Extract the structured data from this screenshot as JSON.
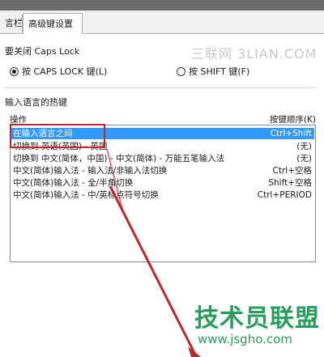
{
  "tabs": [
    {
      "label": "言栏",
      "active": false
    },
    {
      "label": "高级键设置",
      "active": true
    }
  ],
  "caps_lock": {
    "title": "要关闭 Caps Lock",
    "options": [
      {
        "label": "按 CAPS LOCK 键(L)",
        "checked": true
      },
      {
        "label": "按 SHIFT 键(F)",
        "checked": false
      }
    ]
  },
  "watermark_top": "三联网 3LIAN.COM",
  "hotkeys": {
    "title": "输入语言的热键",
    "col_action": "操作",
    "col_keys": "按键顺序(K)",
    "rows": [
      {
        "action": "在输入语言之间",
        "keys": "Ctrl+Shift",
        "selected": true
      },
      {
        "action": "切换到 英语(英国) - 英国",
        "keys": "(无)",
        "selected": false
      },
      {
        "action": "切换到 中文(简体，中国) - 中文(简体) - 万能五笔输入法",
        "keys": "(无)",
        "selected": false
      },
      {
        "action": "中文(简体)输入法 - 输入法/非输入法切换",
        "keys": "Ctrl+空格",
        "selected": false
      },
      {
        "action": "中文(简体)输入法 - 全/半角切换",
        "keys": "Shift+空格",
        "selected": false
      },
      {
        "action": "中文(简体)输入法 - 中/英标点符号切换",
        "keys": "Ctrl+PERIOD",
        "selected": false
      }
    ]
  },
  "watermark_logo": "技术员联盟",
  "watermark_url": "www.jsgho.com",
  "colors": {
    "selection": "#3399ff",
    "annotation": "#c0262c",
    "watermark": "#2a9d5c"
  }
}
